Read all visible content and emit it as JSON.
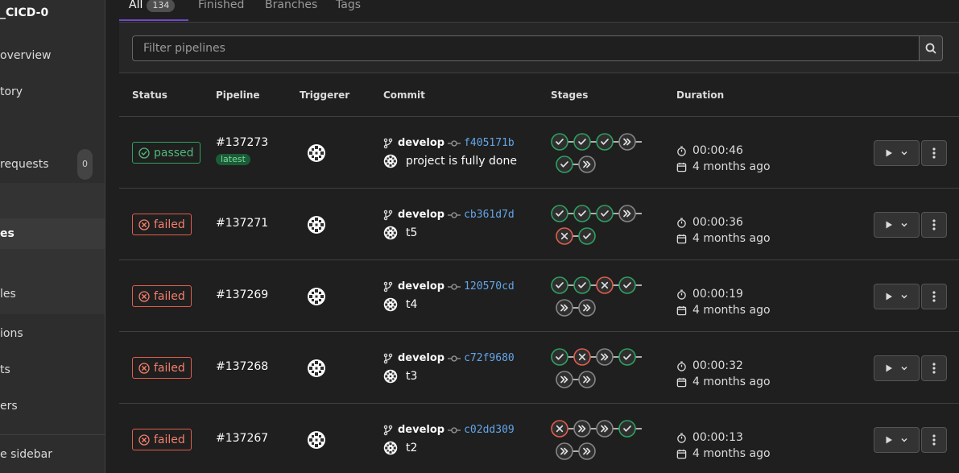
{
  "sidebar": {
    "project_title": "_CICD-0",
    "items": [
      {
        "label": "overview"
      },
      {
        "label": "tory"
      },
      {
        "label": "requests",
        "count": "0"
      },
      {
        "label": "es"
      },
      {
        "label": "les"
      },
      {
        "label": "ions"
      },
      {
        "label": "ts"
      },
      {
        "label": "ers"
      },
      {
        "label": "e sidebar"
      }
    ]
  },
  "tabs": [
    {
      "label": "All",
      "count": "134"
    },
    {
      "label": "Finished"
    },
    {
      "label": "Branches"
    },
    {
      "label": "Tags"
    }
  ],
  "filter": {
    "placeholder": "Filter pipelines"
  },
  "columns": [
    "Status",
    "Pipeline",
    "Triggerer",
    "Commit",
    "Stages",
    "Duration"
  ],
  "pipelines": [
    {
      "status": "passed",
      "id": "#137273",
      "badge": "latest",
      "branch": "develop",
      "sha": "f405171b",
      "message": "project is fully done",
      "stages_row1": [
        "success",
        "success",
        "success",
        "skipped"
      ],
      "stages_row2": [
        "success",
        "skipped"
      ],
      "duration": "00:00:46",
      "finished": "4 months ago"
    },
    {
      "status": "failed",
      "id": "#137271",
      "branch": "develop",
      "sha": "cb361d7d",
      "message": "t5",
      "stages_row1": [
        "success",
        "success",
        "success",
        "skipped"
      ],
      "stages_row2": [
        "failed",
        "success"
      ],
      "duration": "00:00:36",
      "finished": "4 months ago"
    },
    {
      "status": "failed",
      "id": "#137269",
      "branch": "develop",
      "sha": "120570cd",
      "message": "t4",
      "stages_row1": [
        "success",
        "success",
        "failed",
        "success"
      ],
      "stages_row2": [
        "skipped",
        "skipped"
      ],
      "duration": "00:00:19",
      "finished": "4 months ago"
    },
    {
      "status": "failed",
      "id": "#137268",
      "branch": "develop",
      "sha": "c72f9680",
      "message": "t3",
      "stages_row1": [
        "success",
        "failed",
        "skipped",
        "success"
      ],
      "stages_row2": [
        "skipped",
        "skipped"
      ],
      "duration": "00:00:32",
      "finished": "4 months ago"
    },
    {
      "status": "failed",
      "id": "#137267",
      "branch": "develop",
      "sha": "c02dd309",
      "message": "t2",
      "stages_row1": [
        "failed",
        "skipped",
        "skipped",
        "success"
      ],
      "stages_row2": [
        "skipped",
        "skipped"
      ],
      "duration": "00:00:13",
      "finished": "4 months ago"
    }
  ],
  "colors": {
    "success": "#2da160",
    "failed": "#e05e4a",
    "skipped": "#868686",
    "link": "#63a6e9",
    "accent": "#6e49cb"
  }
}
